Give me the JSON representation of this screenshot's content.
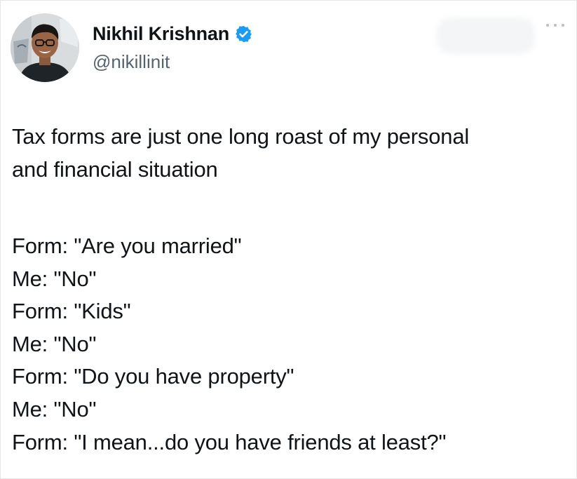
{
  "author": {
    "display_name": "Nikhil Krishnan",
    "handle": "@nikillinit",
    "verified": true,
    "verified_color": "#1d9bf0",
    "avatar_icon": "profile-photo-avatar"
  },
  "menu": {
    "more_icon": "more-options-icon"
  },
  "tweet": {
    "intro_lines": [
      "Tax forms are just one long roast of my personal",
      "and financial situation"
    ],
    "dialogue_lines": [
      "Form: \"Are you married\"",
      "Me: \"No\"",
      "Form: \"Kids\"",
      "Me: \"No\"",
      "Form: \"Do you have property\"",
      "Me: \"No\"",
      "Form: \"I mean...do you have friends at least?\""
    ]
  }
}
